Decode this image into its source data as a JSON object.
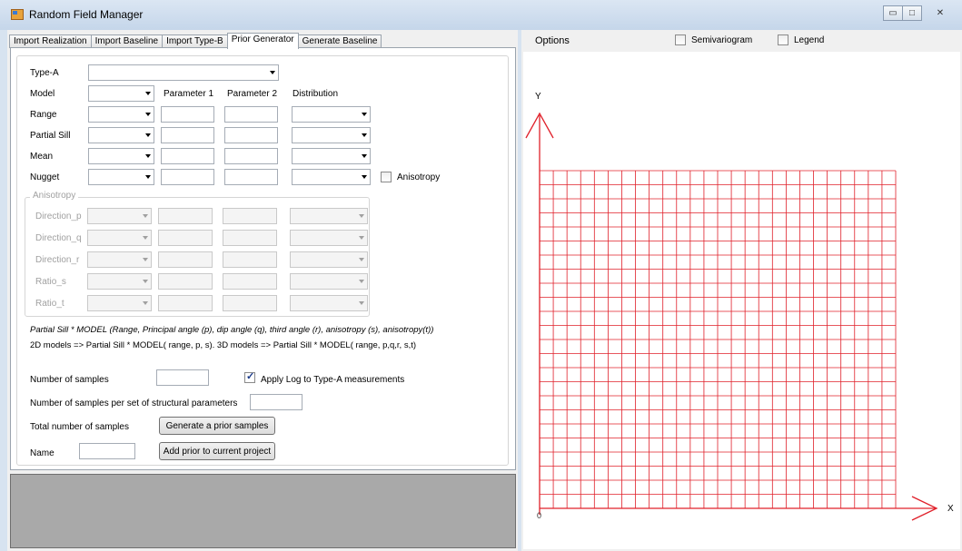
{
  "window": {
    "title": "Random Field Manager"
  },
  "tabs": [
    "Import Realization",
    "Import Baseline",
    "Import Type-B",
    "Prior Generator",
    "Generate Baseline"
  ],
  "form": {
    "type_a_label": "Type-A",
    "model_label": "Model",
    "parameter1_header": "Parameter 1",
    "parameter2_header": "Parameter 2",
    "distribution_header": "Distribution",
    "rows": [
      "Range",
      "Partial Sill",
      "Mean",
      "Nugget"
    ],
    "anisotropy_checkbox": "Anisotropy",
    "anisotropy_group_title": "Anisotropy",
    "anisotropy_rows": [
      "Direction_p",
      "Direction_q",
      "Direction_r",
      "Ratio_s",
      "Ratio_t"
    ],
    "formula_line": "Partial Sill * MODEL (Range, Principal angle (p), dip angle (q), third angle (r), anisotropy (s), anisotropy(t))",
    "models_line": "2D models  => Partial Sill * MODEL( range, p, s).   3D models  => Partial Sill * MODEL( range, p,q,r, s,t)",
    "num_samples_label": "Number of samples",
    "apply_log_label": "Apply  Log to Type-A measurements",
    "apply_log_checked": true,
    "samples_per_set_label": "Number of samples per set of structural parameters",
    "total_samples_label": "Total number of samples",
    "generate_button": "Generate a prior samples",
    "name_label": "Name",
    "add_prior_button": "Add prior to current project"
  },
  "options": {
    "label": "Options",
    "semivariogram_label": "Semivariogram",
    "legend_label": "Legend",
    "semivariogram_checked": false,
    "legend_checked": false
  },
  "plot": {
    "y_axis_label": "Y",
    "x_axis_label": "X",
    "origin_label": "0",
    "grid_color": "#e0202a",
    "axis_color": "#e0202a"
  }
}
